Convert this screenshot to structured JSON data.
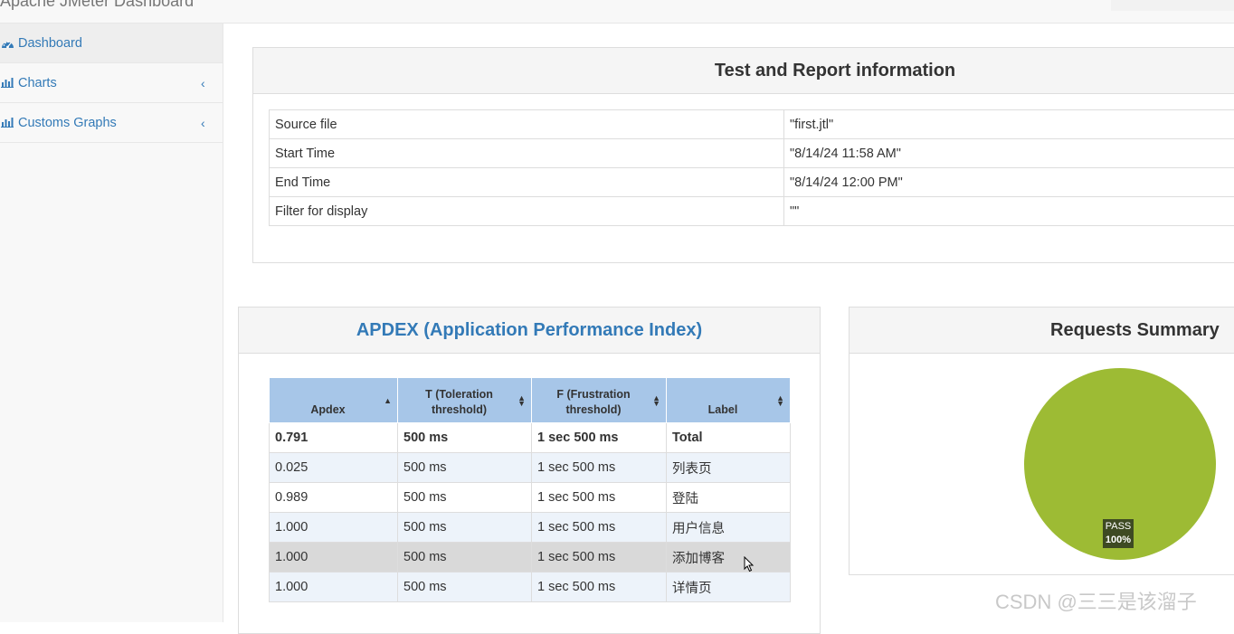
{
  "app": {
    "title": "Apache JMeter Dashboard"
  },
  "sidebar": {
    "items": [
      {
        "label": "Dashboard",
        "icon": "dashboard-icon",
        "active": true
      },
      {
        "label": "Charts",
        "icon": "bar-chart-icon",
        "chevron": "‹"
      },
      {
        "label": "Customs Graphs",
        "icon": "bar-chart-icon",
        "chevron": "‹"
      }
    ]
  },
  "info_panel": {
    "title": "Test and Report information",
    "rows": [
      {
        "key": "Source file",
        "value": "\"first.jtl\""
      },
      {
        "key": "Start Time",
        "value": "\"8/14/24 11:58 AM\""
      },
      {
        "key": "End Time",
        "value": "\"8/14/24 12:00 PM\""
      },
      {
        "key": "Filter for display",
        "value": "\"\""
      }
    ]
  },
  "apdex_panel": {
    "title": "APDEX (Application Performance Index)",
    "headers": [
      "Apdex",
      "T (Toleration threshold)",
      "F (Frustration threshold)",
      "Label"
    ],
    "header_lines": [
      [
        "Apdex"
      ],
      [
        "T (Toleration",
        "threshold)"
      ],
      [
        "F (Frustration",
        "threshold)"
      ],
      [
        "Label"
      ]
    ],
    "rows": [
      {
        "apdex": "0.791",
        "t": "500 ms",
        "f": "1 sec 500 ms",
        "label": "Total"
      },
      {
        "apdex": "0.025",
        "t": "500 ms",
        "f": "1 sec 500 ms",
        "label": "列表页"
      },
      {
        "apdex": "0.989",
        "t": "500 ms",
        "f": "1 sec 500 ms",
        "label": "登陆"
      },
      {
        "apdex": "1.000",
        "t": "500 ms",
        "f": "1 sec 500 ms",
        "label": "用户信息"
      },
      {
        "apdex": "1.000",
        "t": "500 ms",
        "f": "1 sec 500 ms",
        "label": "添加博客"
      },
      {
        "apdex": "1.000",
        "t": "500 ms",
        "f": "1 sec 500 ms",
        "label": "详情页"
      }
    ]
  },
  "summary_panel": {
    "title": "Requests Summary",
    "pie": {
      "label": "PASS",
      "percent": "100%",
      "value": 100,
      "color": "#9dbb34"
    }
  },
  "colors": {
    "link": "#337ab7",
    "header_blue": "#a7c6e8",
    "row_alt": "#edf3fa",
    "pass_green": "#9dbb34"
  },
  "watermark": {
    "text": "CSDN @三三是该溜子"
  }
}
